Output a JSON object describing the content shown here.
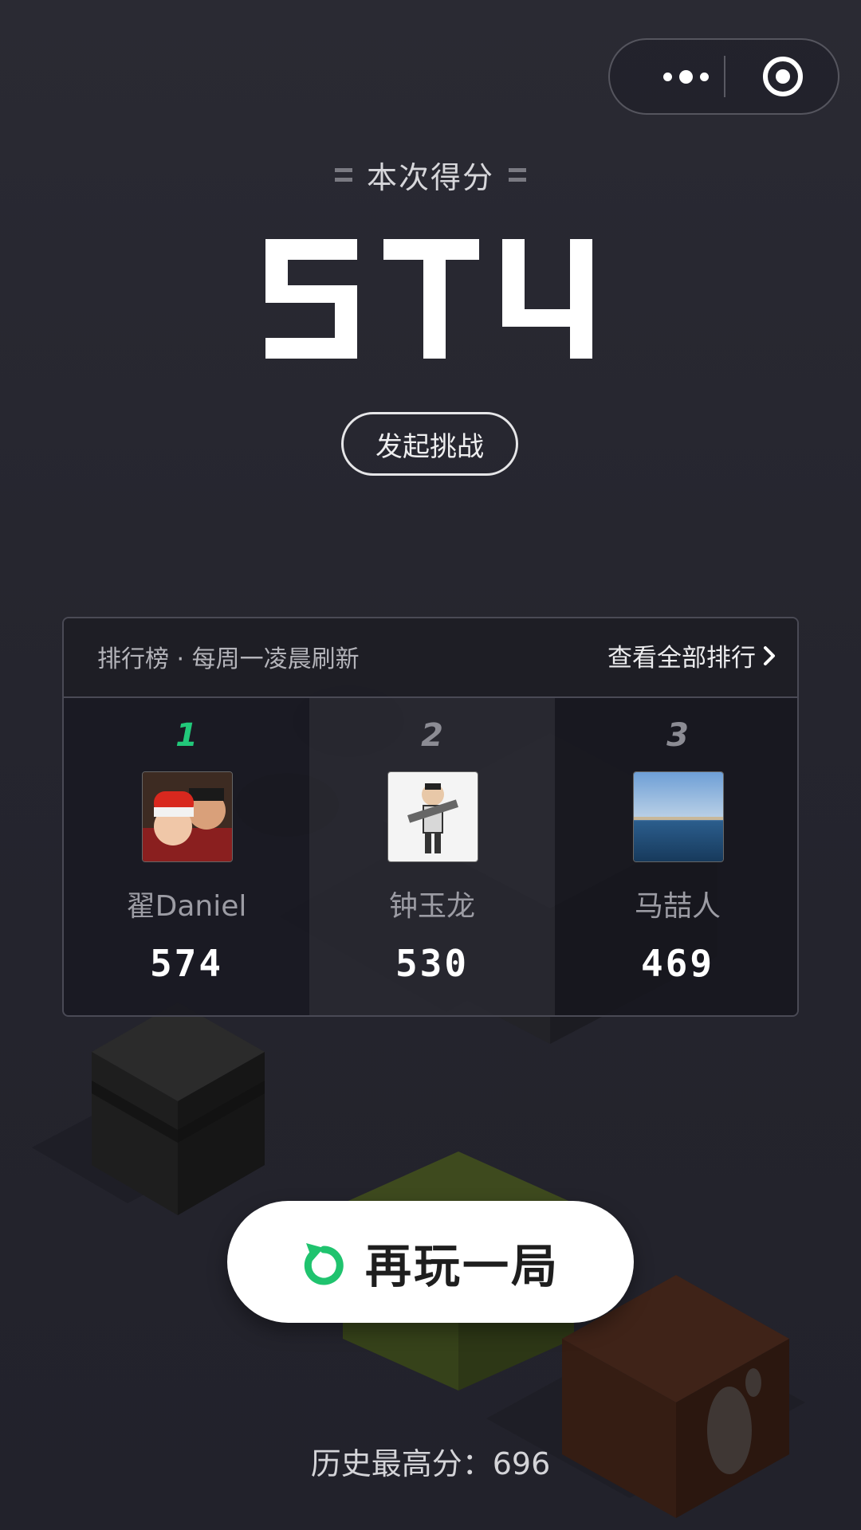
{
  "header": {
    "score_label": "本次得分",
    "current_score": "574",
    "challenge_label": "发起挑战"
  },
  "leaderboard": {
    "title": "排行榜 · 每周一凌晨刷新",
    "view_all_label": "查看全部排行",
    "entries": [
      {
        "rank": "1",
        "name": "翟Daniel",
        "score": "574"
      },
      {
        "rank": "2",
        "name": "钟玉龙",
        "score": "530"
      },
      {
        "rank": "3",
        "name": "马喆人",
        "score": "469"
      }
    ]
  },
  "replay": {
    "label": "再玩一局"
  },
  "best": {
    "text": "历史最高分：696"
  },
  "icons": {
    "menu": "more-dots-icon",
    "close": "target-circle-icon",
    "chevron": "chevron-right-icon",
    "replay": "refresh-icon"
  },
  "colors": {
    "accent_green": "#22c87a",
    "background": "#26262f"
  }
}
